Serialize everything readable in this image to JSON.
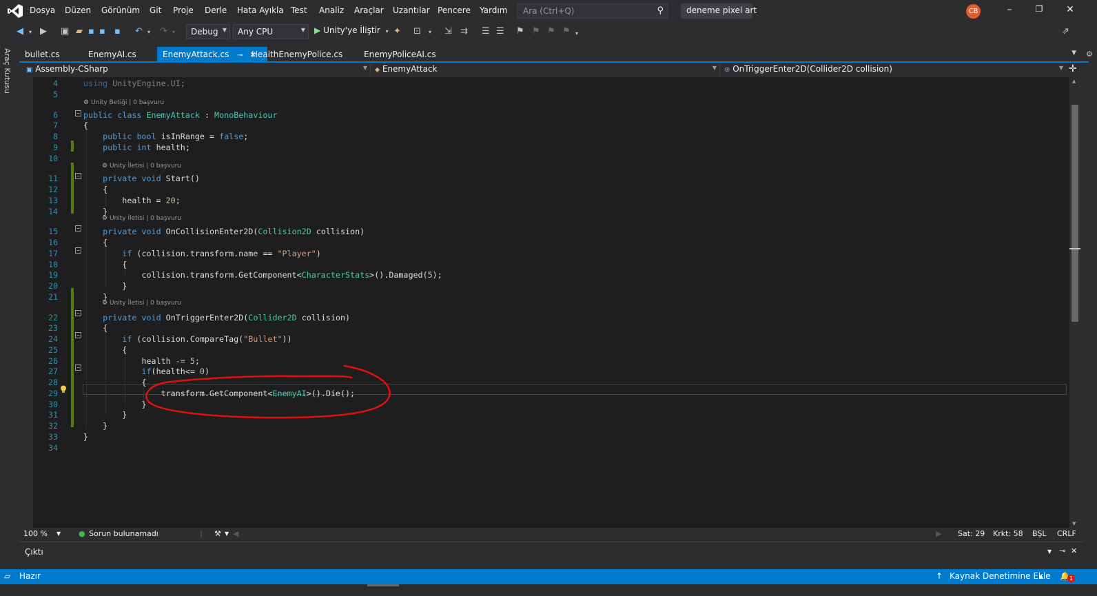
{
  "menu": {
    "items": [
      "Dosya",
      "Düzen",
      "Görünüm",
      "Git",
      "Proje",
      "Derle",
      "Hata Ayıkla",
      "Test",
      "Analiz",
      "Araçlar",
      "Uzantılar",
      "Pencere",
      "Yardım"
    ],
    "search_placeholder": "Ara (Ctrl+Q)",
    "solution_name": "deneme pixel art",
    "avatar_initials": "CB"
  },
  "toolbar": {
    "configuration": "Debug",
    "platform": "Any CPU",
    "run_label": "Unity'ye İliştir"
  },
  "left_strip": {
    "toolbox_label": "Araç Kutusu"
  },
  "tabs": [
    {
      "label": "bullet.cs"
    },
    {
      "label": "EnemyAI.cs"
    },
    {
      "label": "EnemyAttack.cs",
      "active": true
    },
    {
      "label": "HealthEnemyPolice.cs"
    },
    {
      "label": "EnemyPoliceAI.cs"
    }
  ],
  "navbar": {
    "project": "Assembly-CSharp",
    "type": "EnemyAttack",
    "member": "OnTriggerEnter2D(Collider2D collision)"
  },
  "editor": {
    "lines": [
      {
        "n": "4",
        "t": "using UnityEngine.UI;"
      },
      {
        "n": "5",
        "t": ""
      },
      {
        "n": "6",
        "t": "public class EnemyAttack : MonoBehaviour"
      },
      {
        "n": "7",
        "t": "{"
      },
      {
        "n": "8",
        "t": "    public bool isInRange = false;"
      },
      {
        "n": "9",
        "t": "    public int health;"
      },
      {
        "n": "10",
        "t": ""
      },
      {
        "n": "11",
        "t": "    private void Start()"
      },
      {
        "n": "12",
        "t": "    {"
      },
      {
        "n": "13",
        "t": "        health = 20;"
      },
      {
        "n": "14",
        "t": "    }"
      },
      {
        "n": "15",
        "t": "    private void OnCollisionEnter2D(Collision2D collision)"
      },
      {
        "n": "16",
        "t": "    {"
      },
      {
        "n": "17",
        "t": "        if (collision.transform.name == \"Player\")"
      },
      {
        "n": "18",
        "t": "        {"
      },
      {
        "n": "19",
        "t": "            collision.transform.GetComponent<CharacterStats>().Damaged(5);"
      },
      {
        "n": "20",
        "t": "        }"
      },
      {
        "n": "21",
        "t": "    }"
      },
      {
        "n": "22",
        "t": "    private void OnTriggerEnter2D(Collider2D collision)"
      },
      {
        "n": "23",
        "t": "    {"
      },
      {
        "n": "24",
        "t": "        if (collision.CompareTag(\"Bullet\"))"
      },
      {
        "n": "25",
        "t": "        {"
      },
      {
        "n": "26",
        "t": "            health -= 5;"
      },
      {
        "n": "27",
        "t": "            if(health<= 0)"
      },
      {
        "n": "28",
        "t": "            {"
      },
      {
        "n": "29",
        "t": "                transform.GetComponent<EnemyAI>().Die();"
      },
      {
        "n": "30",
        "t": "            }"
      },
      {
        "n": "31",
        "t": "        }"
      },
      {
        "n": "32",
        "t": "    }"
      },
      {
        "n": "33",
        "t": "}"
      },
      {
        "n": "34",
        "t": ""
      }
    ],
    "codelens": [
      {
        "before": "6",
        "text": "Unity Betiği | 0 başvuru"
      },
      {
        "before": "11",
        "text": "Unity İletisi | 0 başvuru"
      },
      {
        "before": "15",
        "text": "Unity İletisi | 0 başvuru"
      },
      {
        "before": "22",
        "text": "Unity İletisi | 0 başvuru"
      }
    ],
    "current_line": "29"
  },
  "editor_status": {
    "zoom": "100 %",
    "issues": "Sorun bulunamadı",
    "line": "Sat: 29",
    "column": "Krkt: 58",
    "mode": "BŞL",
    "line_ending": "CRLF"
  },
  "output": {
    "title": "Çıktı"
  },
  "statusbar": {
    "state": "Hazır",
    "source_control": "Kaynak Denetimine Ekle",
    "notifications": "1"
  },
  "colors": {
    "accent": "#007acc",
    "editor_bg": "#1e1e1e",
    "keyword": "#569cd6",
    "type": "#4ec9b0",
    "string": "#d69d85",
    "number": "#b5cea8",
    "annotation": "#e01010"
  }
}
